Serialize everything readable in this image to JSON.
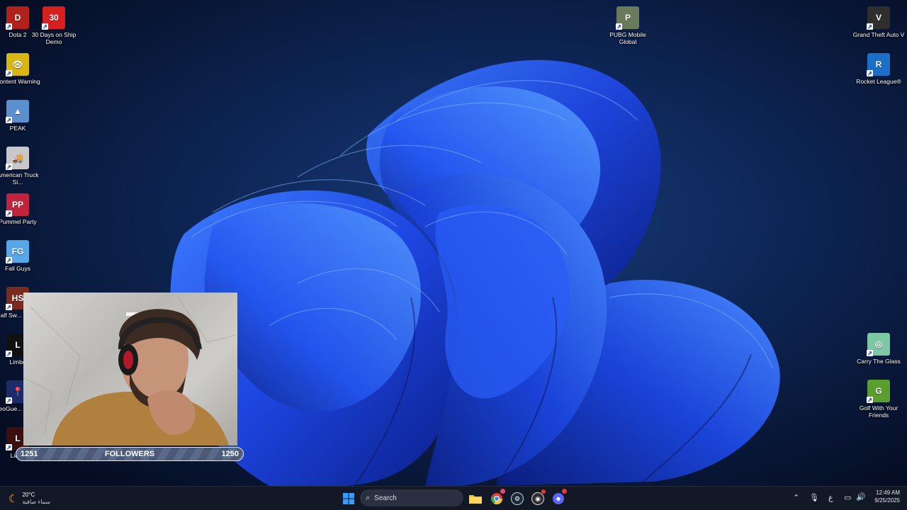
{
  "desktop": {
    "icons_left": [
      {
        "id": "dota2",
        "label": "Dota 2",
        "color": "#b0211c",
        "glyph": "D"
      },
      {
        "id": "30days",
        "label": "30 Days on Ship Demo",
        "color": "#d81f1f",
        "glyph": "30"
      },
      {
        "id": "content-warning",
        "label": "Content Warning",
        "color": "#d8b613",
        "glyph": "👁"
      },
      {
        "id": "peak",
        "label": "PEAK",
        "color": "#5c8fce",
        "glyph": "▲"
      },
      {
        "id": "american-truck",
        "label": "American Truck Si...",
        "color": "#c8c8c8",
        "glyph": "🚚"
      },
      {
        "id": "pummel-party",
        "label": "Pummel Party",
        "color": "#c2243b",
        "glyph": "PP"
      },
      {
        "id": "fall-guys",
        "label": "Fall Guys",
        "color": "#56a6e8",
        "glyph": "FG"
      },
      {
        "id": "half-sword",
        "label": "Half Sw... Demo",
        "color": "#7b2a20",
        "glyph": "HS"
      },
      {
        "id": "limbo",
        "label": "Limbo",
        "color": "#111111",
        "glyph": "L"
      },
      {
        "id": "geoguessr",
        "label": "GeoGue... Steam",
        "color": "#1d2a6b",
        "glyph": "📍"
      },
      {
        "id": "liars",
        "label": "Liar...",
        "color": "#3b0e10",
        "glyph": "L"
      }
    ],
    "icons_right": [
      {
        "id": "pubg",
        "label": "PUBG Mobile Global",
        "color": "#6b7a5d",
        "glyph": "P"
      },
      {
        "id": "gta5",
        "label": "Grand Theft Auto V",
        "color": "#2f2f2f",
        "glyph": "V"
      },
      {
        "id": "rocket-league",
        "label": "Rocket League®",
        "color": "#1b6fc8",
        "glyph": "R"
      },
      {
        "id": "carry-glass",
        "label": "Carry The Glass",
        "color": "#7cc8a4",
        "glyph": "◎"
      },
      {
        "id": "golf-friends",
        "label": "Golf With Your Friends",
        "color": "#5a9e2f",
        "glyph": "G"
      }
    ]
  },
  "stream_overlay": {
    "followers_left": "1251",
    "followers_label": "FOLLOWERS",
    "followers_right": "1250"
  },
  "taskbar": {
    "weather_temp": "20°C",
    "weather_desc": "سماء صافية",
    "search_placeholder": "Search",
    "lang": "ع",
    "time": "12:49 AM",
    "date": "9/25/2025",
    "pinned": [
      "start-icon",
      "file-explorer-icon",
      "chrome-icon",
      "steam-icon",
      "obs-icon",
      "discord-icon"
    ]
  },
  "colors": {
    "wallpaper_bg": "#08152f",
    "bloom_blue": "#1f4ff0",
    "taskbar_bg": "#121826",
    "accent": "#3a8cff"
  }
}
